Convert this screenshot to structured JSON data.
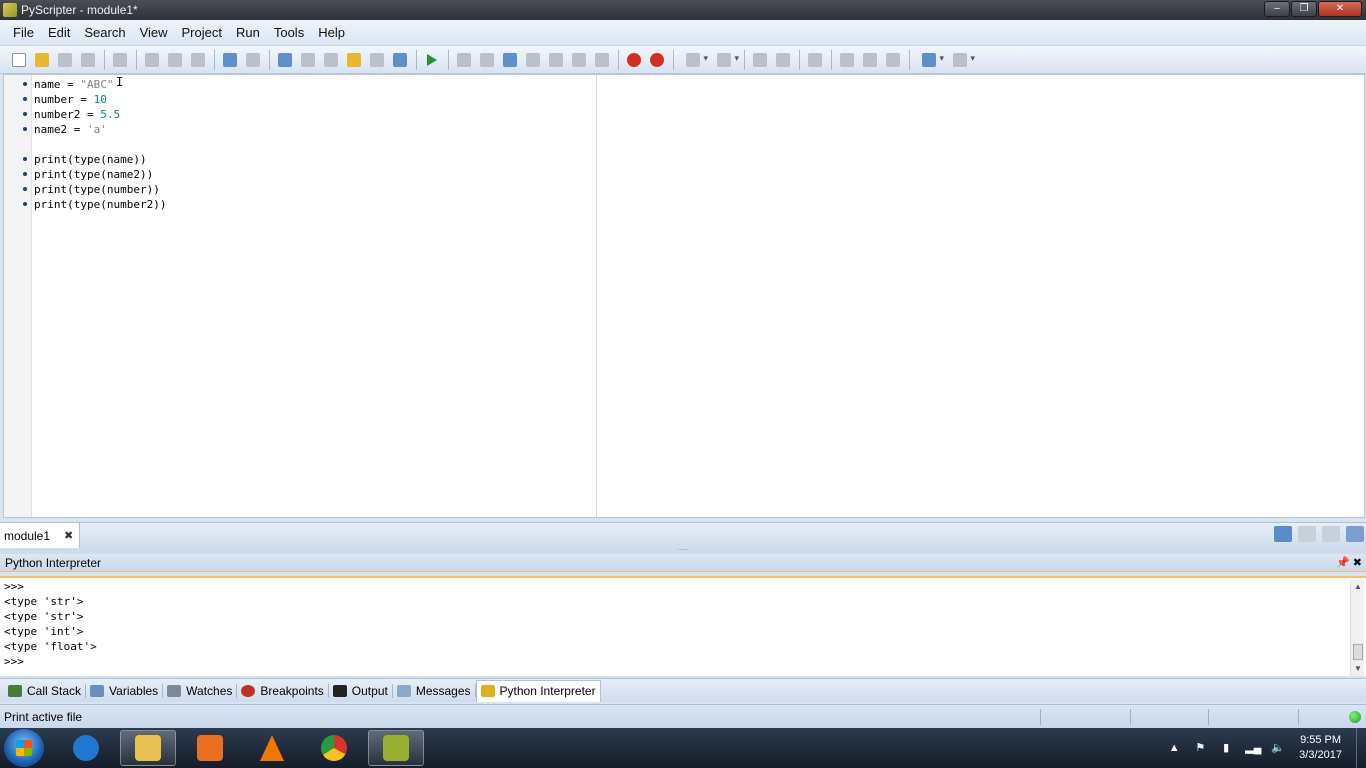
{
  "window": {
    "title": "PyScripter - module1*",
    "controls": {
      "minimize": "‒",
      "maximize": "❐",
      "close": "✕"
    }
  },
  "menu": [
    "File",
    "Edit",
    "Search",
    "View",
    "Project",
    "Run",
    "Tools",
    "Help"
  ],
  "toolbar_icons": [
    "new-file-icon",
    "open-file-icon",
    "save-icon",
    "save-all-icon",
    "print-icon",
    "cut-icon",
    "copy-icon",
    "paste-icon",
    "undo-icon",
    "redo-icon",
    "find-icon",
    "find-next-icon",
    "replace-icon",
    "find-in-files-icon",
    "goto-line-icon",
    "syntax-check-icon",
    "run-icon",
    "debug-icon",
    "step-into-icon",
    "step-over-icon",
    "step-out-icon",
    "pause-icon",
    "abort-icon",
    "toggle-breakpoint-icon",
    "clear-breakpoints-icon",
    "back-icon",
    "forward-icon",
    "indent-icon",
    "dedent-icon",
    "comment-icon",
    "line-numbers-icon",
    "whitespace-icon",
    "special-chars-icon",
    "layout-icon",
    "view-icon"
  ],
  "editor": {
    "lines": [
      {
        "code": "name = \"ABC\""
      },
      {
        "code": "number = 10"
      },
      {
        "code": "number2 = 5.5"
      },
      {
        "code": "name2 = 'a'"
      },
      {
        "code": ""
      },
      {
        "code": "print(type(name))"
      },
      {
        "code": "print(type(name2))"
      },
      {
        "code": "print(type(number))"
      },
      {
        "code": "print(type(number2))"
      }
    ],
    "tab_label": "module1",
    "tab_close": "✖"
  },
  "interpreter": {
    "title": "Python Interpreter",
    "header_controls": "📌 ✖",
    "output": [
      ">>>",
      "<type 'str'>",
      "<type 'str'>",
      "<type 'int'>",
      "<type 'float'>",
      ">>>"
    ]
  },
  "panel_tabs": [
    {
      "label": "Call Stack",
      "icon": "call-stack-icon",
      "color": "#4a7a3a"
    },
    {
      "label": "Variables",
      "icon": "variables-icon",
      "color": "#6a8fb8"
    },
    {
      "label": "Watches",
      "icon": "watches-icon",
      "color": "#7a8a9a"
    },
    {
      "label": "Breakpoints",
      "icon": "breakpoints-icon",
      "color": "#c03020"
    },
    {
      "label": "Output",
      "icon": "output-icon",
      "color": "#222222"
    },
    {
      "label": "Messages",
      "icon": "messages-icon",
      "color": "#8aa8c8"
    },
    {
      "label": "Python Interpreter",
      "icon": "python-icon",
      "color": "#e0b020",
      "active": true
    }
  ],
  "status": {
    "text": "Print active file",
    "indicator_color": "#18a018"
  },
  "taskbar": {
    "apps": [
      {
        "name": "internet-explorer",
        "color": "#1e78d0"
      },
      {
        "name": "file-explorer",
        "color": "#e8c050"
      },
      {
        "name": "media-player",
        "color": "#e87020"
      },
      {
        "name": "vlc",
        "color": "#f07800"
      },
      {
        "name": "chrome",
        "color": "#d8352a"
      },
      {
        "name": "pyscripter",
        "color": "#9ab030",
        "active": true
      }
    ],
    "clock_time": "9:55 PM",
    "clock_date": "3/3/2017"
  }
}
